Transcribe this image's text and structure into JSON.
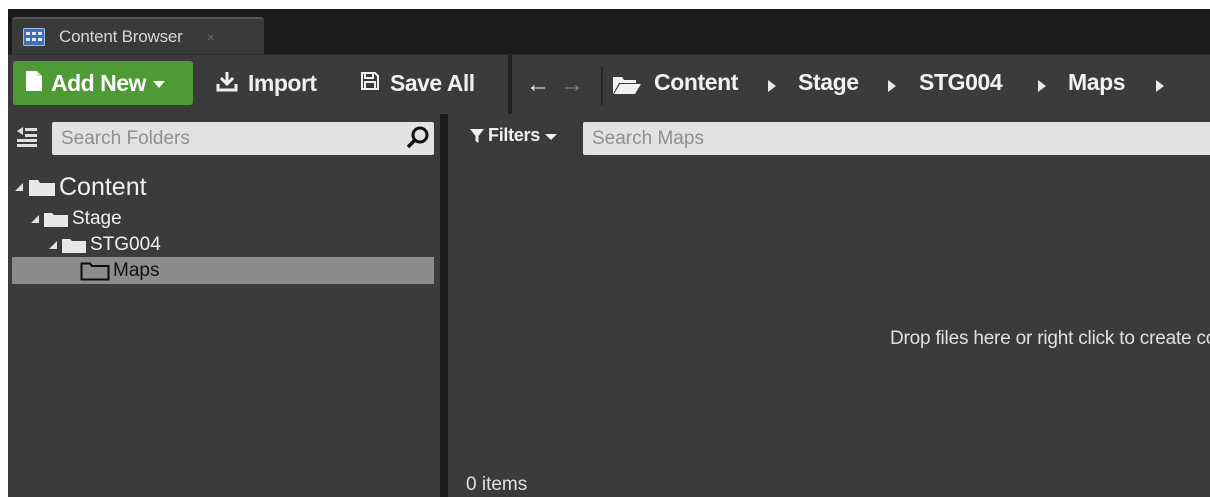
{
  "tab": {
    "icon": "content-browser-icon",
    "title": "Content Browser",
    "close": "×"
  },
  "toolbar": {
    "add_new": "Add New",
    "import": "Import",
    "save_all": "Save All",
    "add_new_color": "#4e9a35"
  },
  "nav": {
    "back": "←",
    "forward": "→",
    "breadcrumbs": [
      "Content",
      "Stage",
      "STG004",
      "Maps"
    ]
  },
  "folders": {
    "search_placeholder": "Search Folders",
    "tree": [
      {
        "label": "Content",
        "depth": 0,
        "expanded": true
      },
      {
        "label": "Stage",
        "depth": 1,
        "expanded": true
      },
      {
        "label": "STG004",
        "depth": 2,
        "expanded": true
      },
      {
        "label": "Maps",
        "depth": 3,
        "selected": true
      }
    ],
    "selected_color": "#8c8c8c"
  },
  "assets": {
    "filters_label": "Filters",
    "search_placeholder": "Search Maps",
    "drop_hint": "Drop files here or right click to create content.",
    "item_count": "0 items"
  }
}
